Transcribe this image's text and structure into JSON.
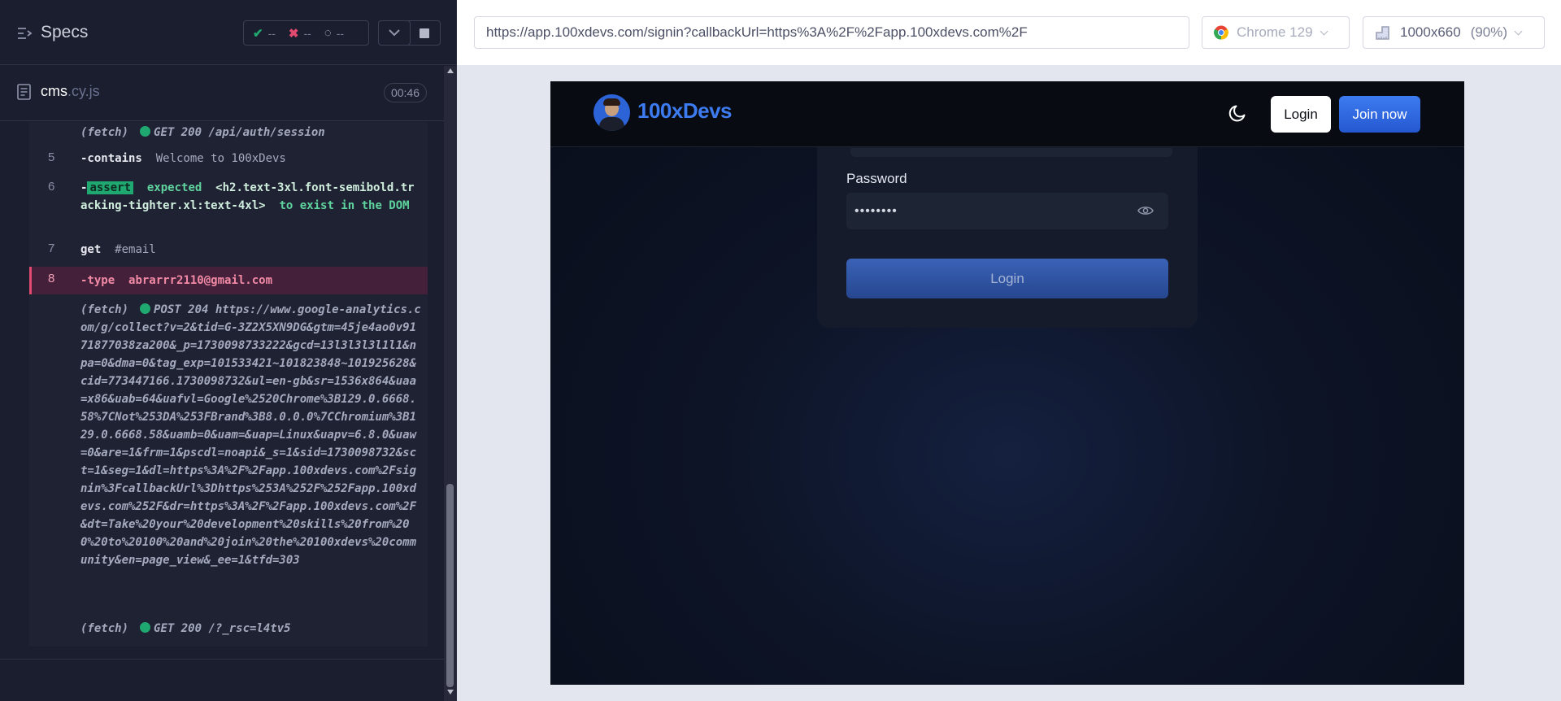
{
  "reporter": {
    "title": "Specs",
    "stats": {
      "passed": "--",
      "failed": "--",
      "pending": "--"
    },
    "file": {
      "name": "cms",
      "ext": ".cy.js",
      "duration": "00:46"
    },
    "commands": [
      {
        "type": "fetch",
        "label": "(fetch)",
        "method": "GET 200 /api/auth/session"
      },
      {
        "num": "5",
        "name": "-contains",
        "message": "Welcome to 100xDevs"
      },
      {
        "num": "6",
        "prefix": "-",
        "badge": "assert",
        "expected": "expected",
        "element": "<h2.text-3xl.font-semibold.tracking-tighter.xl:text-4xl>",
        "tail": "to exist in the DOM"
      },
      {
        "num": "7",
        "name": "get",
        "message": "#email"
      },
      {
        "num": "8",
        "name": "-type",
        "message": "abrarrr2110@gmail.com"
      },
      {
        "type": "fetch",
        "label": "(fetch)",
        "method": "POST 204 https://www.google-analytics.com/g/collect?v=2&tid=G-3Z2X5XN9DG&gtm=45je4ao0v9171877038za200&_p=1730098733222&gcd=13l3l3l3l1l1&npa=0&dma=0&tag_exp=101533421~101823848~101925628&cid=773447166.1730098732&ul=en-gb&sr=1536x864&uaa=x86&uab=64&uafvl=Google%2520Chrome%3B129.0.6668.58%7CNot%253DA%253FBrand%3B8.0.0.0%7CChromium%3B129.0.6668.58&uamb=0&uam=&uap=Linux&uapv=6.8.0&uaw=0&are=1&frm=1&pscdl=noapi&_s=1&sid=1730098732&sct=1&seg=1&dl=https%3A%2F%2Fapp.100xdevs.com%2Fsignin%3FcallbackUrl%3Dhttps%253A%252F%252Fapp.100xdevs.com%252F&dr=https%3A%2F%2Fapp.100xdevs.com%2F&dt=Take%20your%20development%20skills%20from%200%20to%20100%20and%20join%20the%20100xdevs%20community&en=page_view&_ee=1&tfd=303"
      },
      {
        "type": "fetch",
        "label": "(fetch)",
        "method": "GET 200 /?_rsc=l4tv5"
      }
    ]
  },
  "aut": {
    "url": "https://app.100xdevs.com/signin?callbackUrl=https%3A%2F%2Fapp.100xdevs.com%2F",
    "browser": "Chrome 129",
    "viewport": "1000x660",
    "zoom": "(90%)"
  },
  "site": {
    "brand": "100xDevs",
    "nav_login": "Login",
    "nav_join": "Join now",
    "password_label": "Password",
    "password_value": "••••••••",
    "login_button": "Login"
  },
  "colors": {
    "reporter_bg": "#1b1e2e",
    "passed": "#1fa971",
    "failed": "#e34a6f",
    "brand_blue": "#3d7bf0"
  }
}
